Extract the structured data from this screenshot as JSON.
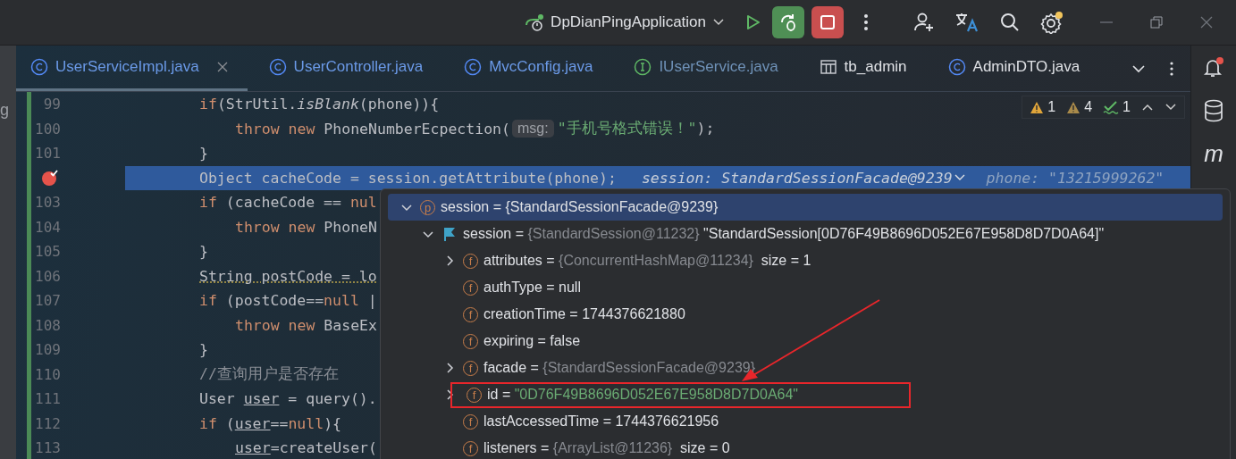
{
  "title_bar": {
    "run_config": "DpDianPingApplication",
    "debug_active": true,
    "stop_active": true,
    "settings_badge": true
  },
  "left_panel": {
    "text": "g"
  },
  "tabs": [
    {
      "label": "UserServiceImpl.java",
      "kind": "class",
      "selected": true,
      "modified": true,
      "closable": true
    },
    {
      "label": "UserController.java",
      "kind": "class",
      "selected": false,
      "modified": true,
      "closable": false
    },
    {
      "label": "MvcConfig.java",
      "kind": "class",
      "selected": false,
      "modified": true,
      "closable": false
    },
    {
      "label": "IUserService.java",
      "kind": "interface",
      "selected": false,
      "modified": true,
      "closable": false
    },
    {
      "label": "tb_admin",
      "kind": "table",
      "selected": false,
      "modified": false,
      "closable": false
    },
    {
      "label": "AdminDTO.java",
      "kind": "class",
      "selected": false,
      "modified": false,
      "closable": false
    }
  ],
  "inspections": [
    {
      "kind": "error",
      "count": "1"
    },
    {
      "kind": "warning",
      "count": "4"
    },
    {
      "kind": "ok",
      "count": "1"
    }
  ],
  "code_lines": [
    {
      "number": "99",
      "indented": false,
      "breakpoint": false,
      "current": false,
      "tokens": [
        {
          "kind": "kw",
          "t": "if"
        },
        {
          "kind": "plain",
          "t": "(StrUtil."
        },
        {
          "kind": "italic",
          "t": "isBlank"
        },
        {
          "kind": "plain",
          "t": "(phone)){"
        }
      ]
    },
    {
      "number": "100",
      "indented": true,
      "breakpoint": false,
      "current": false,
      "tokens": [
        {
          "kind": "kw",
          "t": "throw new"
        },
        {
          "kind": "plain",
          "t": " PhoneNumberEcpection("
        },
        {
          "kind": "hint",
          "t": "msg:"
        },
        {
          "kind": "string",
          "t": "\"手机号格式错误！\""
        },
        {
          "kind": "plain",
          "t": ");"
        }
      ]
    },
    {
      "number": "101",
      "indented": false,
      "breakpoint": false,
      "current": false,
      "tokens": [
        {
          "kind": "plain",
          "t": "}"
        }
      ]
    },
    {
      "indented": false,
      "breakpoint": true,
      "current": true,
      "tokens": [
        {
          "kind": "plain",
          "t": "Object cacheCode = session.getAttribute(phone);"
        }
      ],
      "inline_values": [
        {
          "text": "session: StandardSessionFacade@9239",
          "dim": false,
          "dropdown": true
        },
        {
          "text": "phone: \"13215999262\"",
          "dim": true,
          "dropdown": false
        }
      ]
    },
    {
      "number": "103",
      "indented": false,
      "breakpoint": false,
      "current": false,
      "tokens": [
        {
          "kind": "kw",
          "t": "if"
        },
        {
          "kind": "plain",
          "t": " (cacheCode == "
        },
        {
          "kind": "kw",
          "t": "nul"
        }
      ]
    },
    {
      "number": "104",
      "indented": true,
      "breakpoint": false,
      "current": false,
      "tokens": [
        {
          "kind": "kw",
          "t": "throw new"
        },
        {
          "kind": "plain",
          "t": " PhoneN"
        }
      ]
    },
    {
      "number": "105",
      "indented": false,
      "breakpoint": false,
      "current": false,
      "tokens": [
        {
          "kind": "plain",
          "t": "}"
        }
      ]
    },
    {
      "number": "106",
      "indented": false,
      "breakpoint": false,
      "current": false,
      "tokens": [
        {
          "kind": "warn",
          "t": "String postCode = lo"
        }
      ]
    },
    {
      "number": "107",
      "indented": false,
      "breakpoint": false,
      "current": false,
      "tokens": [
        {
          "kind": "kw",
          "t": "if"
        },
        {
          "kind": "plain",
          "t": " (postCode=="
        },
        {
          "kind": "kw",
          "t": "null"
        },
        {
          "kind": "plain",
          "t": " |"
        }
      ]
    },
    {
      "number": "108",
      "indented": true,
      "breakpoint": false,
      "current": false,
      "tokens": [
        {
          "kind": "kw",
          "t": "throw new"
        },
        {
          "kind": "plain",
          "t": " BaseEx"
        }
      ]
    },
    {
      "number": "109",
      "indented": false,
      "breakpoint": false,
      "current": false,
      "tokens": [
        {
          "kind": "plain",
          "t": "}"
        }
      ]
    },
    {
      "number": "110",
      "indented": false,
      "breakpoint": false,
      "current": false,
      "tokens": [
        {
          "kind": "comment",
          "t": "//查询用户是否存在"
        }
      ]
    },
    {
      "number": "111",
      "indented": false,
      "breakpoint": false,
      "current": false,
      "tokens": [
        {
          "kind": "plain",
          "t": "User "
        },
        {
          "kind": "ul",
          "t": "user"
        },
        {
          "kind": "plain",
          "t": " = query()."
        }
      ]
    },
    {
      "number": "112",
      "indented": false,
      "breakpoint": false,
      "current": false,
      "tokens": [
        {
          "kind": "kw",
          "t": "if"
        },
        {
          "kind": "plain",
          "t": " ("
        },
        {
          "kind": "ul",
          "t": "user"
        },
        {
          "kind": "plain",
          "t": "=="
        },
        {
          "kind": "kw",
          "t": "null"
        },
        {
          "kind": "plain",
          "t": "){"
        }
      ]
    },
    {
      "number": "113",
      "indented": true,
      "breakpoint": false,
      "current": false,
      "tokens": [
        {
          "kind": "ul",
          "t": "user"
        },
        {
          "kind": "plain",
          "t": "=createUser("
        }
      ]
    }
  ],
  "debug_popup": {
    "tree": [
      {
        "kind": "param",
        "badge": "p",
        "name": "session",
        "selected": true,
        "expanded": true,
        "value": [
          {
            "kind": "plain",
            "t": " = {StandardSessionFacade@9239}"
          }
        ],
        "children": [
          {
            "kind": "flag",
            "name": "session",
            "selected": false,
            "expanded": true,
            "highlighted": false,
            "value": [
              {
                "kind": "plain",
                "t": " = "
              },
              {
                "kind": "ref",
                "t": "{StandardSession@11232}"
              },
              {
                "kind": "plain",
                "t": " \"StandardSession[0D76F49B8696D052E67E958D8D7D0A64]\""
              }
            ],
            "children": [
              {
                "kind": "field",
                "badge": "f",
                "name": "attributes",
                "selected": false,
                "expanded": false,
                "highlighted": false,
                "value": [
                  {
                    "kind": "plain",
                    "t": " = "
                  },
                  {
                    "kind": "ref",
                    "t": "{ConcurrentHashMap@11234}"
                  },
                  {
                    "kind": "plain",
                    "t": "  size = 1"
                  }
                ]
              },
              {
                "kind": "field",
                "badge": "f",
                "name": "authType",
                "selected": false,
                "highlighted": false,
                "value": [
                  {
                    "kind": "plain",
                    "t": " = null"
                  }
                ]
              },
              {
                "kind": "field",
                "badge": "f",
                "name": "creationTime",
                "selected": false,
                "highlighted": false,
                "value": [
                  {
                    "kind": "plain",
                    "t": " = 1744376621880"
                  }
                ]
              },
              {
                "kind": "field",
                "badge": "f",
                "name": "expiring",
                "selected": false,
                "highlighted": false,
                "value": [
                  {
                    "kind": "plain",
                    "t": " = false"
                  }
                ]
              },
              {
                "kind": "field",
                "badge": "f",
                "name": "facade",
                "selected": false,
                "expanded": false,
                "highlighted": false,
                "value": [
                  {
                    "kind": "plain",
                    "t": " = "
                  },
                  {
                    "kind": "ref",
                    "t": "{StandardSessionFacade@9239}"
                  }
                ]
              },
              {
                "kind": "field",
                "badge": "f",
                "name": "id",
                "selected": false,
                "expanded": false,
                "highlighted": true,
                "value": [
                  {
                    "kind": "plain",
                    "t": " = "
                  },
                  {
                    "kind": "string",
                    "t": "\"0D76F49B8696D052E67E958D8D7D0A64\""
                  }
                ]
              },
              {
                "kind": "field",
                "badge": "f",
                "name": "lastAccessedTime",
                "selected": false,
                "highlighted": false,
                "value": [
                  {
                    "kind": "plain",
                    "t": " = 1744376621956"
                  }
                ]
              },
              {
                "kind": "field",
                "badge": "f",
                "name": "listeners",
                "selected": false,
                "highlighted": false,
                "value": [
                  {
                    "kind": "plain",
                    "t": " = "
                  },
                  {
                    "kind": "ref",
                    "t": "{ArrayList@11236}"
                  },
                  {
                    "kind": "plain",
                    "t": "  size = 0"
                  }
                ]
              }
            ]
          }
        ]
      }
    ]
  },
  "right_sidebar": {
    "notification_badge": true,
    "maven_label": "m"
  }
}
